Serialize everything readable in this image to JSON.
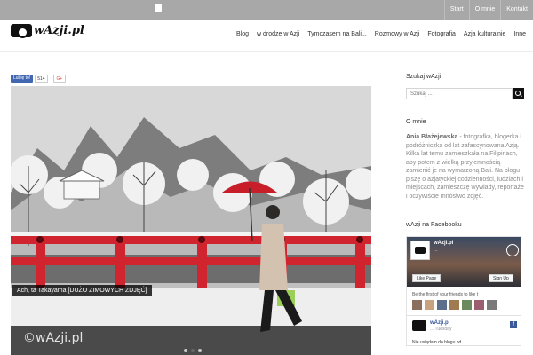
{
  "topbar": {
    "links": [
      "Start",
      "O mnie",
      "Kontakt"
    ]
  },
  "header": {
    "logo_text": "wAzji.pl",
    "nav": [
      "Blog",
      "w drodze w Azji",
      "Tymczasem na Bali...",
      "Rozmowy w Azji",
      "Fotografia",
      "Azja kulturalnie",
      "Inne"
    ]
  },
  "post": {
    "fb_like_label": "Lubię to!",
    "fb_like_count": "514",
    "gplus_label": "G+",
    "hero_caption": "Ach, ta Takayama [DUŻO ZIMOWYCH ZDJĘĆ]",
    "watermark": "©wAzji.pl",
    "slider_dots": 3,
    "slider_active": 1
  },
  "sidebar": {
    "search": {
      "title": "Szukaj wAzji",
      "placeholder": "Szukaj ..."
    },
    "about": {
      "title": "O mnie",
      "author": "Ania Błażejewska",
      "text": " - fotografka, blogerka i podróżniczka od lat zafascynowana Azją. Kilka lat temu zamieszkała na Filipinach, aby potem z wielką przyjemnością zamienić je na wymarzoną Bali. Na blogu piszę o azjatyckiej codzienności, ludziach i miejscach, zamieszczę wywiady, reportaże i oczywiście mnóstwo zdjęć."
    },
    "facebook": {
      "title": "wAzji na Facebooku",
      "page_name": "wAzji.pl",
      "page_likes": "...",
      "like_page_label": "Like Page",
      "signup_label": "Sign Up",
      "friends_text": "Be the first of your friends to like t",
      "post_name": "wAzji.pl",
      "post_sub": "... Tuesday",
      "post_text": "Nie usiądam do blogu od ..."
    }
  },
  "colors": {
    "topbar_bg": "#a8a8a8",
    "bridge_red": "#d0242f",
    "umbrella_red": "#c81e2a",
    "fb_blue": "#3b5998"
  }
}
